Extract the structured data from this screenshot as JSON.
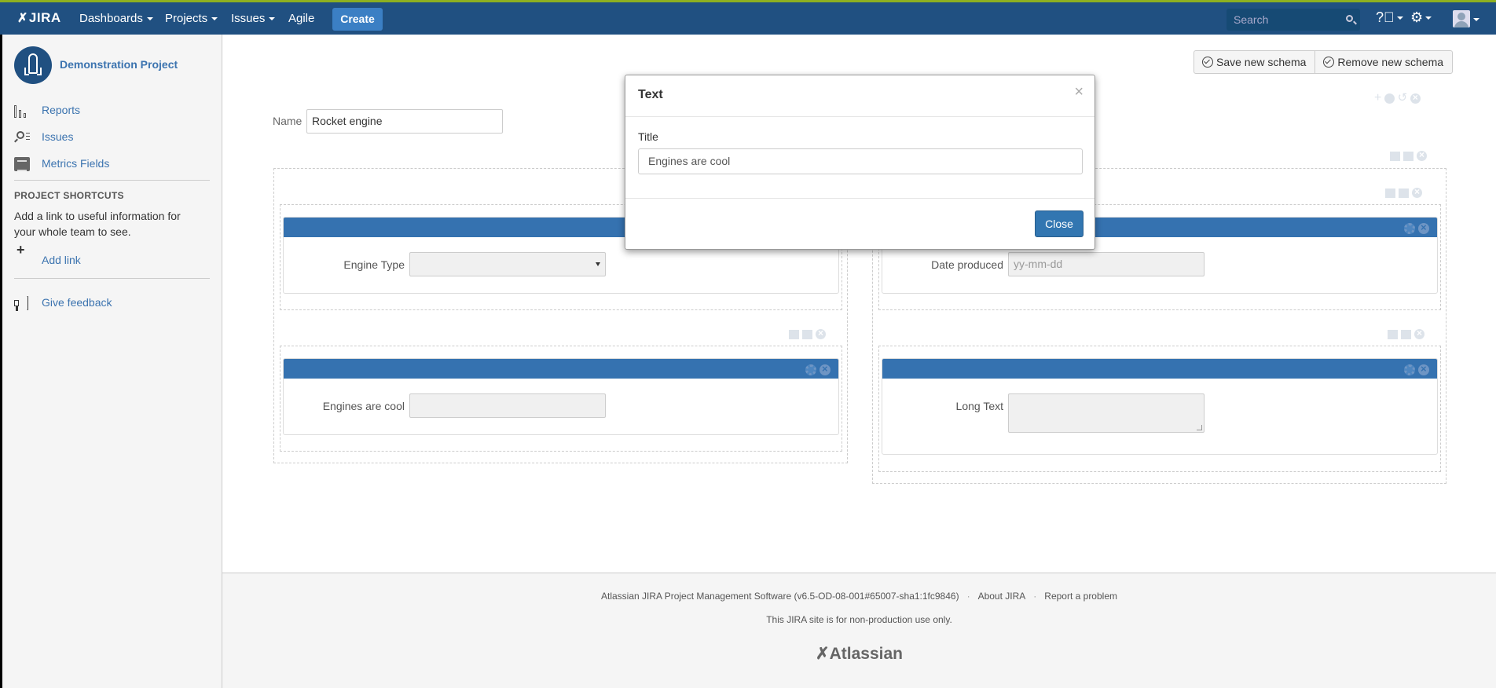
{
  "topbar": {
    "logo": "JIRA",
    "nav": [
      "Dashboards",
      "Projects",
      "Issues",
      "Agile"
    ],
    "create_label": "Create",
    "search_placeholder": "Search",
    "help_icon": "help-icon",
    "settings_icon": "gear-icon",
    "user_icon": "avatar-icon"
  },
  "colors": {
    "header_bg": "#205081",
    "accent": "#3b7fc4",
    "panel_head": "#3572b0"
  },
  "sidebar": {
    "project_name": "Demonstration Project",
    "items": [
      {
        "label": "Reports",
        "icon": "bar-chart-icon"
      },
      {
        "label": "Issues",
        "icon": "issues-search-icon"
      },
      {
        "label": "Metrics Fields",
        "icon": "metrics-icon"
      }
    ],
    "shortcuts_title": "PROJECT SHORTCUTS",
    "shortcuts_desc": "Add a link to useful information for your whole team to see.",
    "add_link": "Add link",
    "feedback": "Give feedback"
  },
  "main": {
    "save_label": "Save new schema",
    "remove_label": "Remove new schema",
    "name_label": "Name",
    "name_value": "Rocket engine",
    "fields": {
      "engine_type": "Engine Type",
      "engines_cool": "Engines are cool",
      "date_produced": "Date produced",
      "date_placeholder": "yy-mm-dd",
      "long_text": "Long Text"
    }
  },
  "modal": {
    "title": "Text",
    "close_x": "×",
    "field_label": "Title",
    "field_value": "Engines are cool",
    "close_button": "Close"
  },
  "footer": {
    "software": "Atlassian JIRA Project Management Software (v6.5-OD-08-001#65007-sha1:1fc9846)",
    "about": "About JIRA",
    "report": "Report a problem",
    "notice": "This JIRA site is for non-production use only.",
    "brand": "Atlassian"
  }
}
